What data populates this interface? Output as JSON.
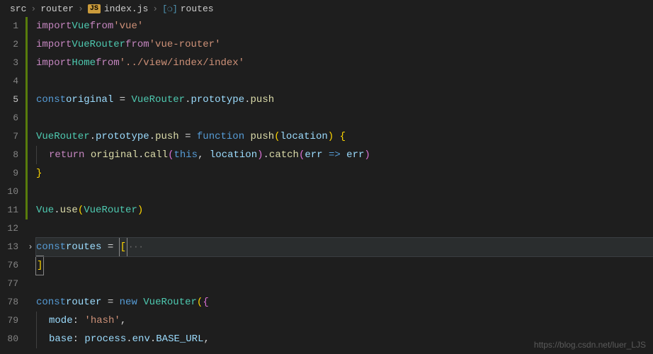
{
  "breadcrumb": {
    "items": [
      "src",
      "router"
    ],
    "filename": "index.js",
    "symbol": "routes"
  },
  "lines": [
    {
      "n": "1",
      "m": true
    },
    {
      "n": "2",
      "m": true
    },
    {
      "n": "3",
      "m": true
    },
    {
      "n": "4",
      "m": true
    },
    {
      "n": "5",
      "m": true,
      "active": true
    },
    {
      "n": "6",
      "m": true
    },
    {
      "n": "7",
      "m": true
    },
    {
      "n": "8",
      "m": true
    },
    {
      "n": "9",
      "m": true
    },
    {
      "n": "10",
      "m": true
    },
    {
      "n": "11",
      "m": true
    },
    {
      "n": "12",
      "m": false
    },
    {
      "n": "13",
      "m": false,
      "fold": true,
      "hl": true
    },
    {
      "n": "76",
      "m": false
    },
    {
      "n": "77",
      "m": false
    },
    {
      "n": "78",
      "m": false
    },
    {
      "n": "79",
      "m": false
    },
    {
      "n": "80",
      "m": false
    }
  ],
  "code": {
    "l1": {
      "import": "import",
      "v": "Vue",
      "from": "from",
      "s": "'vue'"
    },
    "l2": {
      "import": "import",
      "v": "VueRouter",
      "from": "from",
      "s": "'vue-router'"
    },
    "l3": {
      "import": "import",
      "v": "Home",
      "from": "from",
      "s": "'../view/index/index'"
    },
    "l5": {
      "const": "const",
      "v": "original",
      "eq": " = ",
      "cls": "VueRouter",
      "d1": ".",
      "p1": "prototype",
      "d2": ".",
      "p2": "push"
    },
    "l7": {
      "cls": "VueRouter",
      "d1": ".",
      "p1": "prototype",
      "d2": ".",
      "p2": "push",
      "eq": " = ",
      "fnkw": "function",
      "sp": " ",
      "fn": "push",
      "op": "(",
      "arg": "location",
      "cp": ") ",
      "ob": "{"
    },
    "l8": {
      "ret": "return",
      "sp": " ",
      "v": "original",
      "d": ".",
      "fn": "call",
      "op": "(",
      "this": "this",
      "c": ", ",
      "arg": "location",
      "cp": ")",
      "d2": ".",
      "fn2": "catch",
      "op2": "(",
      "e": "err",
      "ar": " => ",
      "e2": "err",
      "cp2": ")"
    },
    "l9": {
      "cb": "}"
    },
    "l11": {
      "cls": "Vue",
      "d": ".",
      "fn": "use",
      "op": "(",
      "arg": "VueRouter",
      "cp": ")"
    },
    "l13": {
      "const": "const",
      "v": "routes",
      "eq": " = ",
      "ob": "[",
      "el": "···"
    },
    "l76": {
      "cb": "]"
    },
    "l78": {
      "const": "const",
      "v": "router",
      "eq": " = ",
      "new": "new",
      "sp": " ",
      "cls": "VueRouter",
      "op": "(",
      "ob": "{"
    },
    "l79": {
      "k": "mode",
      "c": ": ",
      "s": "'hash'",
      "t": ","
    },
    "l80": {
      "k": "base",
      "c": ": ",
      "v": "process",
      "d": ".",
      "v2": "env",
      "d2": ".",
      "v3": "BASE_URL",
      "t": ","
    }
  },
  "watermark": "https://blog.csdn.net/luer_LJS"
}
